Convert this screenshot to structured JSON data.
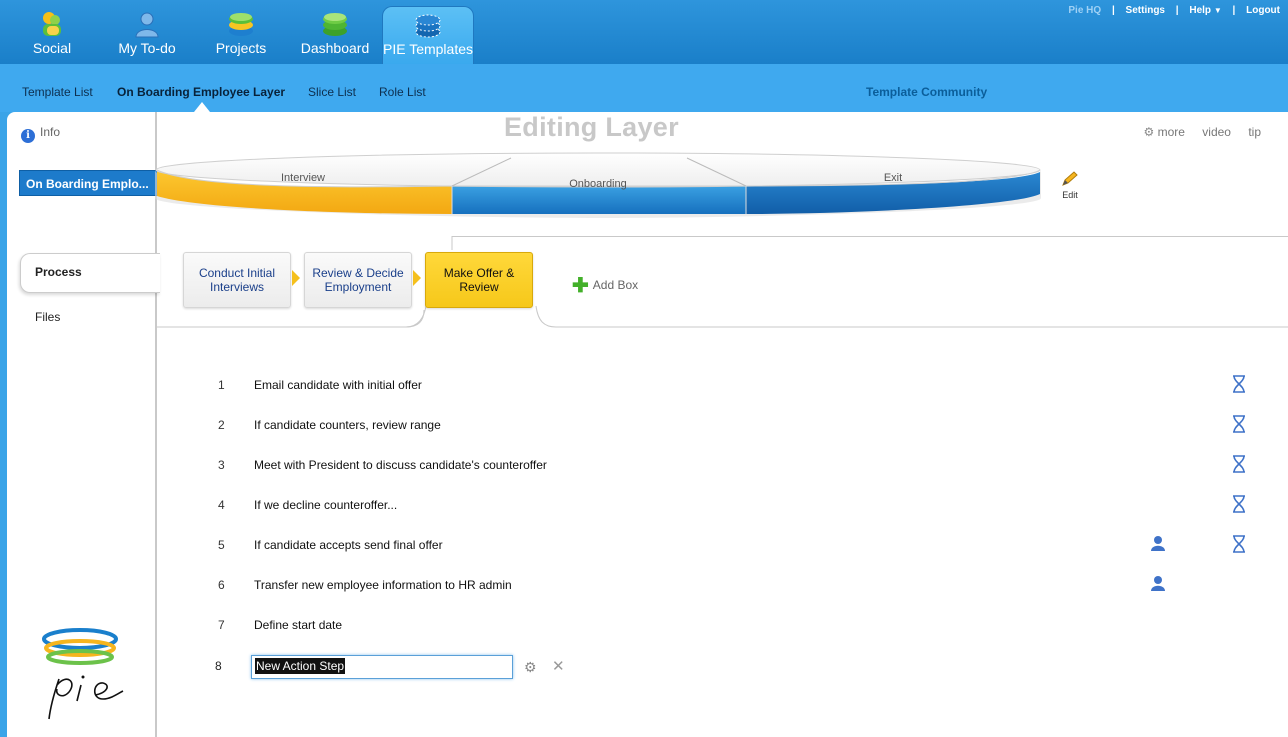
{
  "topnav": {
    "tabs": [
      {
        "label": "Social",
        "icon": "social-icon"
      },
      {
        "label": "My To-do",
        "icon": "user-icon"
      },
      {
        "label": "Projects",
        "icon": "projects-icon"
      },
      {
        "label": "Dashboard",
        "icon": "dashboard-icon"
      },
      {
        "label": "PIE Templates",
        "icon": "templates-icon"
      }
    ],
    "active_tab": "PIE Templates",
    "links": {
      "pie_hq": "Pie HQ",
      "settings": "Settings",
      "help": "Help",
      "logout": "Logout"
    }
  },
  "subnav": {
    "items": [
      "Template List",
      "On Boarding Employee Layer",
      "Slice List",
      "Role List"
    ],
    "active": "On Boarding Employee Layer",
    "community": "Template Community"
  },
  "sidebar": {
    "info": "Info",
    "layer": "On Boarding Emplo...",
    "process": "Process",
    "files": "Files"
  },
  "header": {
    "title": "Editing Layer",
    "more": "more",
    "video": "video",
    "tip": "tip",
    "edit": "Edit"
  },
  "pie_slices": [
    {
      "label": "Interview",
      "color": "#f9b820"
    },
    {
      "label": "Onboarding",
      "color": "#2f8fd3"
    },
    {
      "label": "Exit",
      "color": "#1c74c0"
    }
  ],
  "process_boxes": [
    {
      "label": "Conduct Initial Interviews"
    },
    {
      "label": "Review & Decide Employment"
    },
    {
      "label": "Make Offer & Review"
    }
  ],
  "active_box": "Make Offer & Review",
  "add_box": "Add Box",
  "steps": [
    {
      "num": "1",
      "text": "Email candidate with initial offer",
      "person": false,
      "hourglass": true
    },
    {
      "num": "2",
      "text": "If candidate counters, review range",
      "person": false,
      "hourglass": true
    },
    {
      "num": "3",
      "text": "Meet with President to discuss candidate's counteroffer",
      "person": false,
      "hourglass": true
    },
    {
      "num": "4",
      "text": "If we decline counteroffer...",
      "person": false,
      "hourglass": true
    },
    {
      "num": "5",
      "text": "If candidate accepts send final offer",
      "person": true,
      "hourglass": true
    },
    {
      "num": "6",
      "text": "Transfer new employee information to HR admin",
      "person": true,
      "hourglass": false
    },
    {
      "num": "7",
      "text": "Define start date",
      "person": false,
      "hourglass": false
    }
  ],
  "new_step": {
    "num": "8",
    "value": "New Action Step"
  },
  "colors": {
    "accent": "#1d7bcb",
    "topbar": "#2e95dc",
    "subnav": "#3fa9ef",
    "active_box": "#f6c81a"
  }
}
